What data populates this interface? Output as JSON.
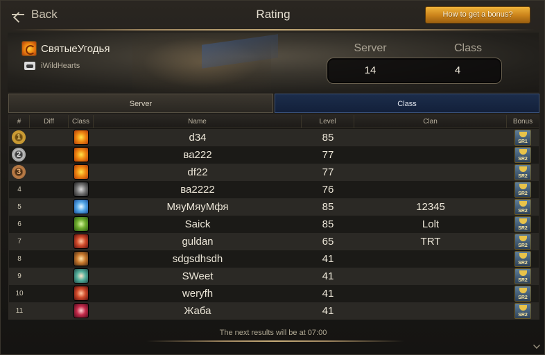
{
  "header": {
    "back_label": "Back",
    "title": "Rating",
    "bonus_button": "How to get a bonus?"
  },
  "player": {
    "name": "СвятыеУгодья",
    "guild": "iWildHearts",
    "class_icon": "fire-class-icon"
  },
  "ranks": {
    "server_label": "Server",
    "class_label": "Class",
    "server_value": "14",
    "class_value": "4"
  },
  "tabs": [
    {
      "label": "Server",
      "active": false
    },
    {
      "label": "Class",
      "active": true
    }
  ],
  "columns": {
    "rank": "#",
    "diff": "Diff",
    "class": "Class",
    "name": "Name",
    "level": "Level",
    "clan": "Clan",
    "bonus": "Bonus"
  },
  "rows": [
    {
      "rank": "1",
      "medal": "gold",
      "class_icon": "fire",
      "name": "d34",
      "level": "85",
      "clan": "",
      "bonus": "SR1"
    },
    {
      "rank": "2",
      "medal": "silver",
      "class_icon": "fire",
      "name": "ва222",
      "level": "77",
      "clan": "",
      "bonus": "SR2"
    },
    {
      "rank": "3",
      "medal": "bronze",
      "class_icon": "fire",
      "name": "df22",
      "level": "77",
      "clan": "",
      "bonus": "SR2"
    },
    {
      "rank": "4",
      "medal": "",
      "class_icon": "steel",
      "name": "ва2222",
      "level": "76",
      "clan": "",
      "bonus": "SR2"
    },
    {
      "rank": "5",
      "medal": "",
      "class_icon": "ice",
      "name": "МяуМяуМфя",
      "level": "85",
      "clan": "12345",
      "bonus": "SR2"
    },
    {
      "rank": "6",
      "medal": "",
      "class_icon": "nature",
      "name": "Saick",
      "level": "85",
      "clan": "Lolt",
      "bonus": "SR2"
    },
    {
      "rank": "7",
      "medal": "",
      "class_icon": "blood",
      "name": "guldan",
      "level": "65",
      "clan": "TRT",
      "bonus": "SR2"
    },
    {
      "rank": "8",
      "medal": "",
      "class_icon": "bard",
      "name": "sdgsdhsdh",
      "level": "41",
      "clan": "",
      "bonus": "SR2"
    },
    {
      "rank": "9",
      "medal": "",
      "class_icon": "mint",
      "name": "SWeet",
      "level": "41",
      "clan": "",
      "bonus": "SR2"
    },
    {
      "rank": "10",
      "medal": "",
      "class_icon": "blood",
      "name": "weryfh",
      "level": "41",
      "clan": "",
      "bonus": "SR2"
    },
    {
      "rank": "11",
      "medal": "",
      "class_icon": "ruby",
      "name": "Жаба",
      "level": "41",
      "clan": "",
      "bonus": "SR2"
    }
  ],
  "footer": {
    "note": "The next results will be at 07:00"
  },
  "colors": {
    "accent_gold": "#f0b33a",
    "active_tab": "#1c2d4b"
  }
}
